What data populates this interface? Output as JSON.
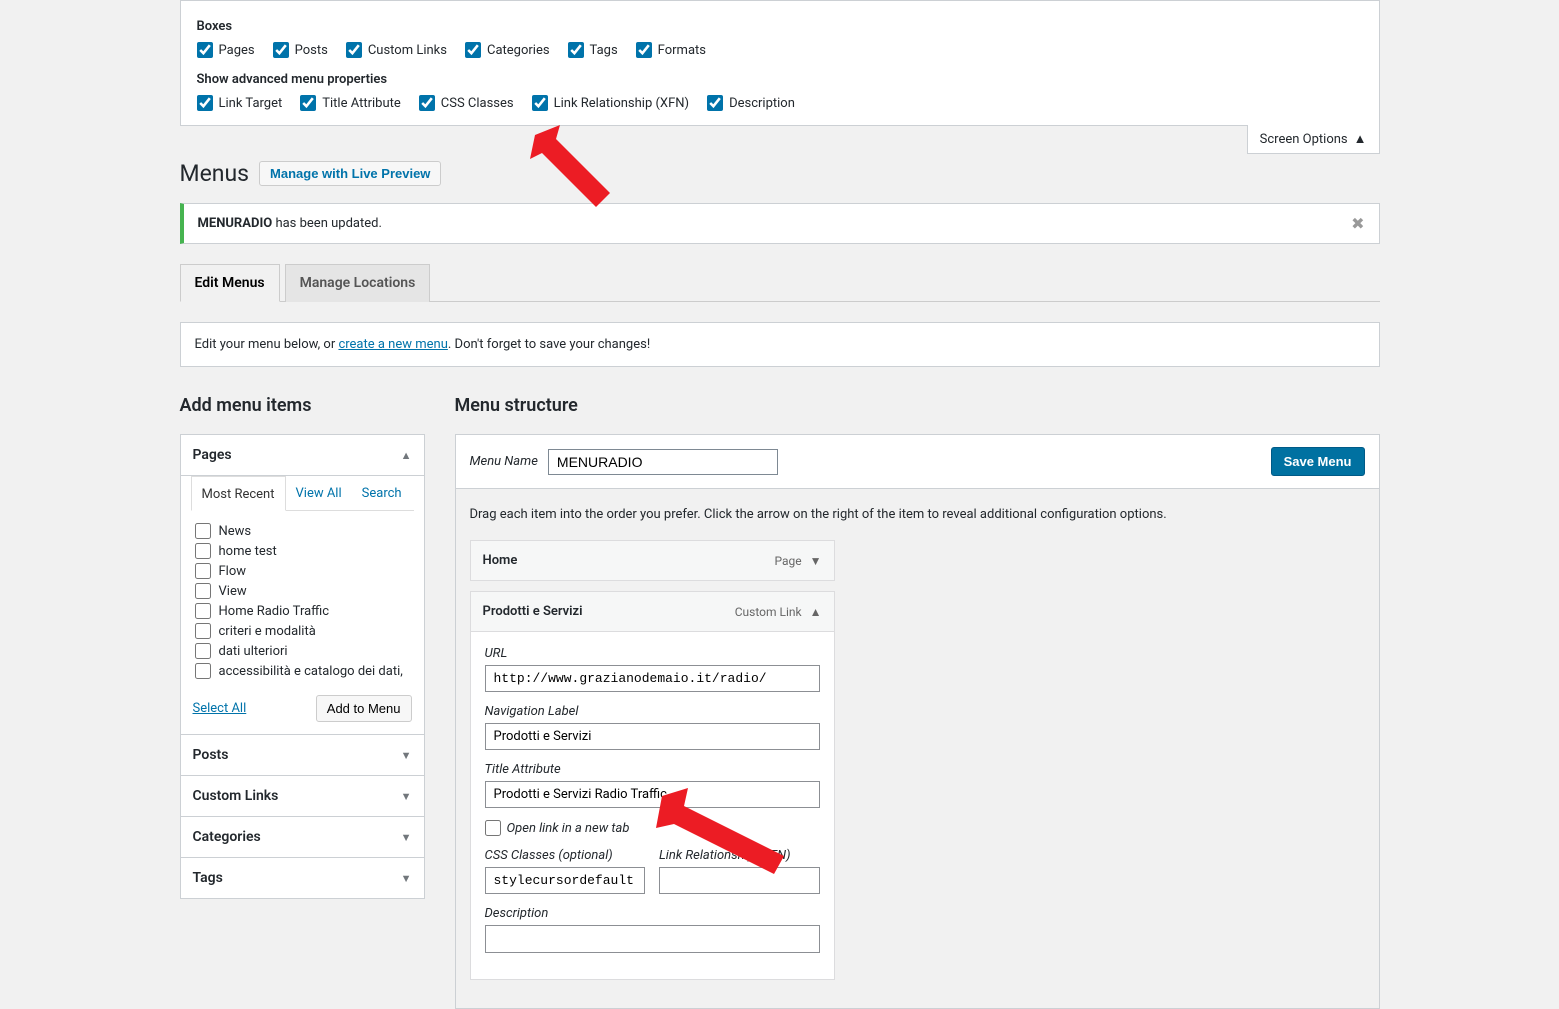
{
  "screen_options": {
    "boxes_heading": "Boxes",
    "boxes": [
      {
        "label": "Pages",
        "checked": true
      },
      {
        "label": "Posts",
        "checked": true
      },
      {
        "label": "Custom Links",
        "checked": true
      },
      {
        "label": "Categories",
        "checked": true
      },
      {
        "label": "Tags",
        "checked": true
      },
      {
        "label": "Formats",
        "checked": true
      }
    ],
    "advanced_heading": "Show advanced menu properties",
    "advanced": [
      {
        "label": "Link Target",
        "checked": true
      },
      {
        "label": "Title Attribute",
        "checked": true
      },
      {
        "label": "CSS Classes",
        "checked": true
      },
      {
        "label": "Link Relationship (XFN)",
        "checked": true
      },
      {
        "label": "Description",
        "checked": true
      }
    ],
    "tab_label": "Screen Options"
  },
  "page_title": "Menus",
  "live_preview_btn": "Manage with Live Preview",
  "notice": {
    "bold": "MENURADIO",
    "text": " has been updated."
  },
  "tabs": [
    {
      "label": "Edit Menus",
      "active": true
    },
    {
      "label": "Manage Locations",
      "active": false
    }
  ],
  "info_bar": {
    "prefix": "Edit your menu below, or ",
    "link": "create a new menu",
    "suffix": ". Don't forget to save your changes!"
  },
  "left": {
    "heading": "Add menu items",
    "panels": [
      {
        "title": "Pages",
        "open": true
      },
      {
        "title": "Posts",
        "open": false
      },
      {
        "title": "Custom Links",
        "open": false
      },
      {
        "title": "Categories",
        "open": false
      },
      {
        "title": "Tags",
        "open": false
      }
    ],
    "panel_tabs": [
      {
        "label": "Most Recent",
        "active": true
      },
      {
        "label": "View All",
        "active": false
      },
      {
        "label": "Search",
        "active": false
      }
    ],
    "page_items": [
      "News",
      "home test",
      "Flow",
      "View",
      "Home Radio Traffic",
      "criteri e modalità",
      "dati ulteriori",
      "accessibilità e catalogo dei dati,"
    ],
    "select_all": "Select All",
    "add_to_menu": "Add to Menu"
  },
  "right": {
    "heading": "Menu structure",
    "menu_name_label": "Menu Name",
    "menu_name_value": "MENURADIO",
    "save_label": "Save Menu",
    "drag_hint": "Drag each item into the order you prefer. Click the arrow on the right of the item to reveal additional configuration options.",
    "items": [
      {
        "name": "Home",
        "type": "Page",
        "open": false
      },
      {
        "name": "Prodotti e Servizi",
        "type": "Custom Link",
        "open": true
      }
    ],
    "detail": {
      "url_label": "URL",
      "url_value": "http://www.grazianodemaio.it/radio/",
      "nav_label": "Navigation Label",
      "nav_value": "Prodotti e Servizi",
      "title_label": "Title Attribute",
      "title_value": "Prodotti e Servizi Radio Traffic",
      "open_tab": "Open link in a new tab",
      "css_label": "CSS Classes (optional)",
      "css_value": "stylecursordefault",
      "xfn_label": "Link Relationship (XFN)",
      "desc_label": "Description"
    }
  }
}
